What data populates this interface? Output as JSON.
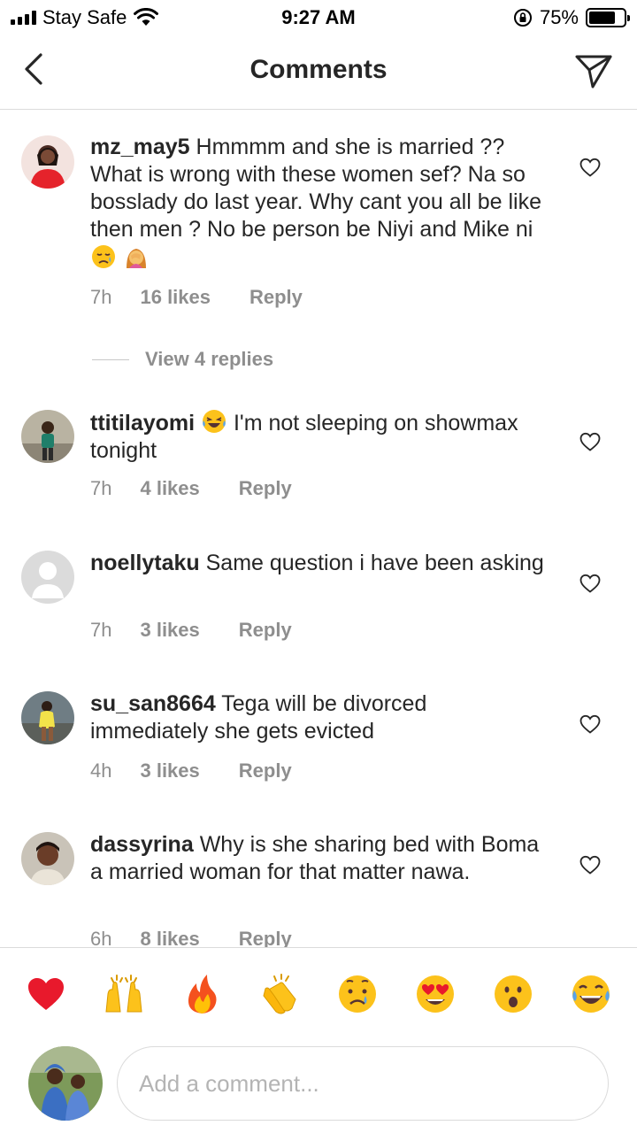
{
  "status_bar": {
    "carrier": "Stay Safe",
    "time": "9:27 AM",
    "battery_percent_label": "75%",
    "battery_level": 0.75
  },
  "nav": {
    "title": "Comments"
  },
  "comments": [
    {
      "user": "mz_may5",
      "text": "Hmmmm and she is married ?? What is wrong with these women sef? Na so bosslady do last year. Why cant you all be like then men ? No be person be Niyi and Mike ni",
      "emojis": [
        "sad-face",
        "facepalm-woman"
      ],
      "time": "7h",
      "likes": "16 likes",
      "reply": "Reply",
      "view_replies": "View 4 replies"
    },
    {
      "user": "ttitilayomi",
      "emoji_lead": "laughing-tears",
      "text": "I'm not sleeping on showmax  tonight",
      "time": "7h",
      "likes": "4 likes",
      "reply": "Reply"
    },
    {
      "user": "noellytaku",
      "text": "Same question i have been asking",
      "time": "7h",
      "likes": "3 likes",
      "reply": "Reply"
    },
    {
      "user": "su_san8664",
      "text": "Tega  will be divorced immediately  she gets  evicted",
      "time": "4h",
      "likes": "3 likes",
      "reply": "Reply"
    },
    {
      "user": "dassyrina",
      "text": "Why is she sharing bed with Boma  a married  woman for that matter nawa.",
      "time": "6h",
      "likes": "8 likes",
      "reply": "Reply"
    }
  ],
  "reactions": [
    "red-heart",
    "raising-hands",
    "fire",
    "clapping-hands",
    "crying-face",
    "heart-eyes",
    "astonished-face",
    "tears-of-joy"
  ],
  "composer": {
    "placeholder": "Add a comment..."
  }
}
